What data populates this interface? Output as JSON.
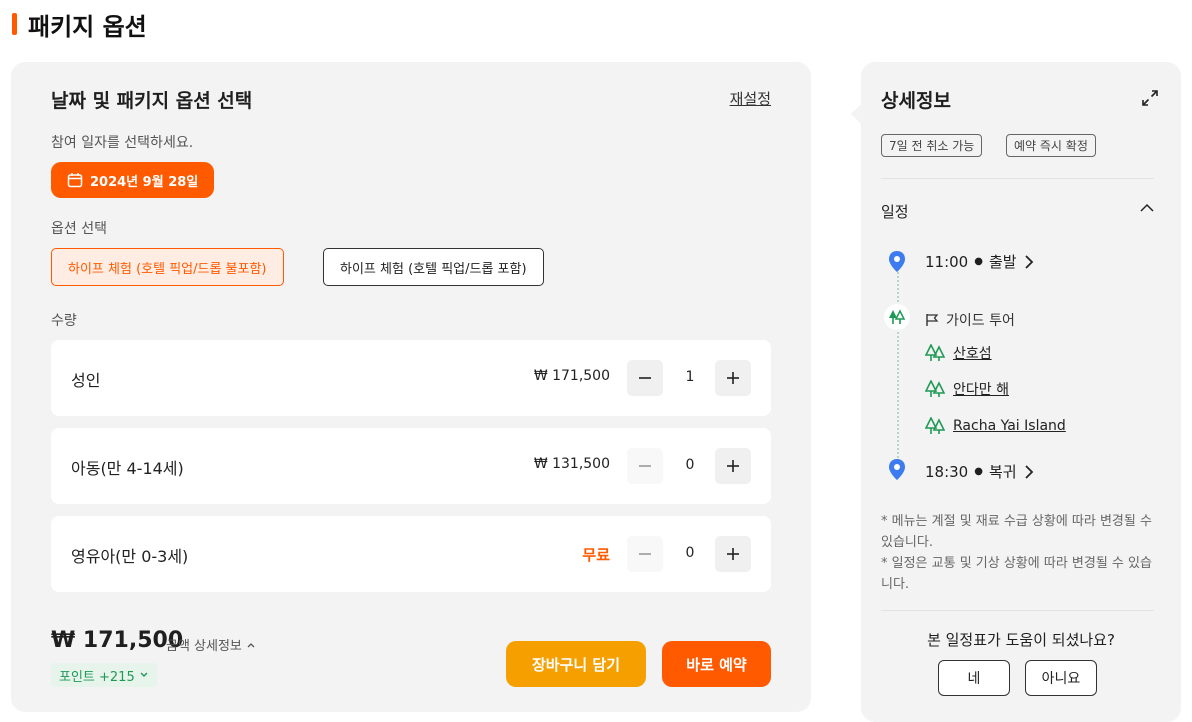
{
  "page": {
    "title": "패키지 옵션",
    "accent": "#ff5a00"
  },
  "selection": {
    "heading": "날짜 및 패키지 옵션 선택",
    "reset": "재설정",
    "date_label": "참여 일자를 선택하세요.",
    "date_value": "2024년 9월 28일",
    "option_label": "옵션 선택",
    "options": [
      {
        "label": "하이프 체험 (호텔 픽업/드롭 불포함)",
        "selected": true
      },
      {
        "label": "하이프 체험 (호텔 픽업/드롭 포함)",
        "selected": false
      }
    ],
    "quantity_label": "수량",
    "rows": [
      {
        "label": "성인",
        "price": "₩ 171,500",
        "qty": "1"
      },
      {
        "label": "아동(만 4-14세)",
        "price": "₩ 131,500",
        "qty": "0"
      },
      {
        "label": "영유아(만 0-3세)",
        "price": "무료",
        "qty": "0"
      }
    ],
    "total": "₩ 171,500",
    "total_detail": "금액 상세정보",
    "points": "포인트 +215",
    "cart_button": "장바구니 담기",
    "book_button": "바로 예약"
  },
  "details": {
    "title": "상세정보",
    "badges": [
      "7일 전 취소 가능",
      "예약 즉시 확정"
    ],
    "schedule_title": "일정",
    "depart": {
      "time": "11:00",
      "label": "출발"
    },
    "guide": "가이드 투어",
    "places": [
      "산호섬",
      "안다만 해",
      "Racha Yai Island"
    ],
    "return": {
      "time": "18:30",
      "label": "복귀"
    },
    "notes": [
      "* 메뉴는 계절 및 재료 수급 상황에 따라 변경될 수 있습니다.",
      "* 일정은 교통 및 기상 상황에 따라 변경될 수 있습니다."
    ],
    "feedback_question": "본 일정표가 도움이 되셨나요?",
    "yes": "네",
    "no": "아니요"
  }
}
